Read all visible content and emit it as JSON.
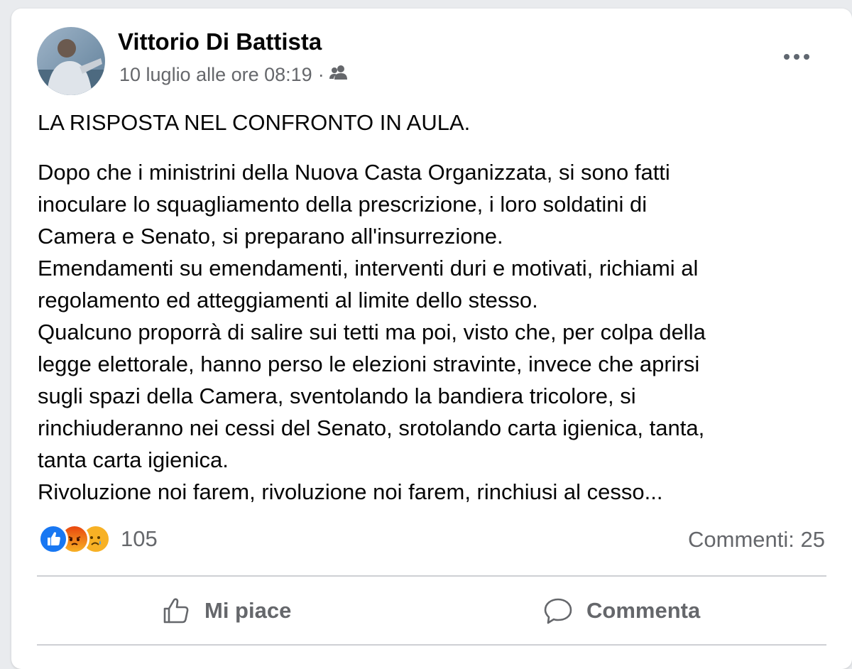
{
  "post": {
    "author": "Vittorio Di Battista",
    "timestamp": "10 luglio alle ore 08:19",
    "separator": "·",
    "audience_icon": "friends-icon",
    "title": "LA RISPOSTA NEL CONFRONTO IN AULA.",
    "body_lines": [
      "Dopo che i ministrini della Nuova Casta Organizzata, si sono fatti",
      "inoculare lo squagliamento della prescrizione, i loro soldatini di",
      "Camera e Senato, si preparano all'insurrezione.",
      "Emendamenti su emendamenti, interventi duri e motivati, richiami al",
      "regolamento ed atteggiamenti al limite dello stesso.",
      "Qualcuno proporrà di salire sui tetti ma poi, visto che, per colpa della",
      "legge elettorale, hanno perso le elezioni stravinte, invece che aprirsi",
      "sugli spazi della Camera, sventolando la bandiera tricolore, si",
      "rinchiuderanno nei cessi del Senato, srotolando carta igienica, tanta,",
      "tanta carta igienica.",
      "Rivoluzione noi farem, rivoluzione noi farem, rinchiusi al cesso..."
    ]
  },
  "reactions": {
    "icons": [
      "like-icon",
      "angry-icon",
      "sad-icon"
    ],
    "count": "105",
    "comments": "Commenti: 25"
  },
  "actions": {
    "like_label": "Mi piace",
    "comment_label": "Commenta"
  },
  "colors": {
    "like_blue": "#1877f2",
    "angry_orange": "#e9710f",
    "sad_yellow": "#f7b125",
    "secondary_text": "#65676b"
  }
}
